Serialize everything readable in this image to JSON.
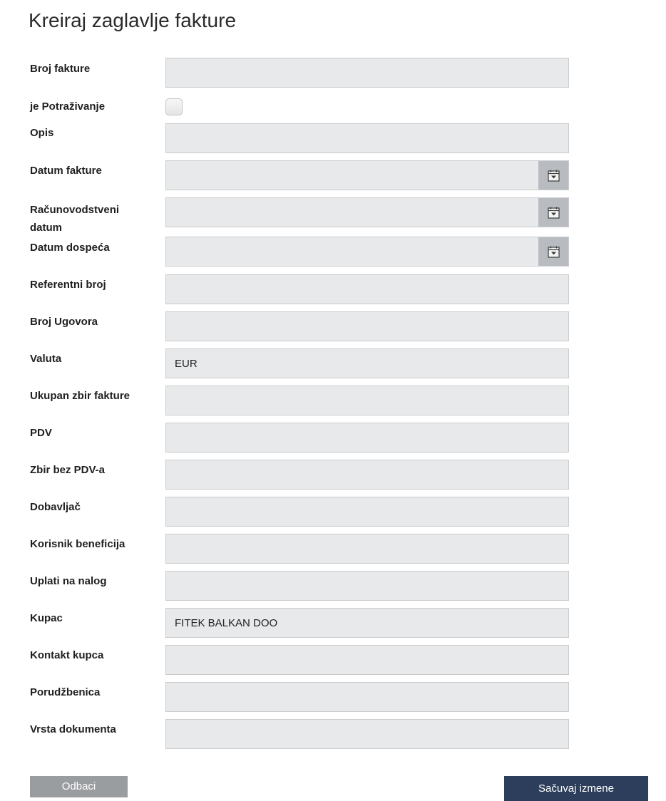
{
  "page": {
    "title": "Kreiraj zaglavlje fakture"
  },
  "form": {
    "broj_fakture": {
      "label": "Broj fakture",
      "value": ""
    },
    "je_potrazivanje": {
      "label": "je Potraživanje",
      "checked": false
    },
    "opis": {
      "label": "Opis",
      "value": ""
    },
    "datum_fakture": {
      "label": "Datum fakture",
      "value": "",
      "icon": "calendar-icon"
    },
    "racunovodstveni_datum": {
      "label_line1": "Računovodstveni",
      "label_line2": "datum",
      "value": "",
      "icon": "calendar-icon"
    },
    "datum_dospeca": {
      "label": "Datum dospeća",
      "value": "",
      "icon": "calendar-icon"
    },
    "referentni_broj": {
      "label": "Referentni broj",
      "value": ""
    },
    "broj_ugovora": {
      "label": "Broj Ugovora",
      "value": ""
    },
    "valuta": {
      "label": "Valuta",
      "value": "EUR"
    },
    "ukupan_zbir": {
      "label": "Ukupan zbir fakture",
      "value": ""
    },
    "pdv": {
      "label": "PDV",
      "value": ""
    },
    "zbir_bez_pdv": {
      "label": "Zbir bez PDV-a",
      "value": ""
    },
    "dobavljac": {
      "label": "Dobavljač",
      "value": ""
    },
    "korisnik_beneficija": {
      "label": "Korisnik beneficija",
      "value": ""
    },
    "uplati_na_nalog": {
      "label": "Uplati na nalog",
      "value": ""
    },
    "kupac": {
      "label": "Kupac",
      "value": "FITEK BALKAN DOO"
    },
    "kontakt_kupca": {
      "label": "Kontakt kupca",
      "value": ""
    },
    "porudzbenica": {
      "label": "Porudžbenica",
      "value": ""
    },
    "vrsta_dokumenta": {
      "label": "Vrsta dokumenta",
      "value": ""
    }
  },
  "actions": {
    "discard_label": "Odbaci",
    "save_label": "Sačuvaj izmene"
  },
  "colors": {
    "input_bg": "#e8e9ea",
    "calendar_button": "#b8bcc0",
    "save_button": "#2c3e5c",
    "discard_button": "#9a9da0"
  }
}
